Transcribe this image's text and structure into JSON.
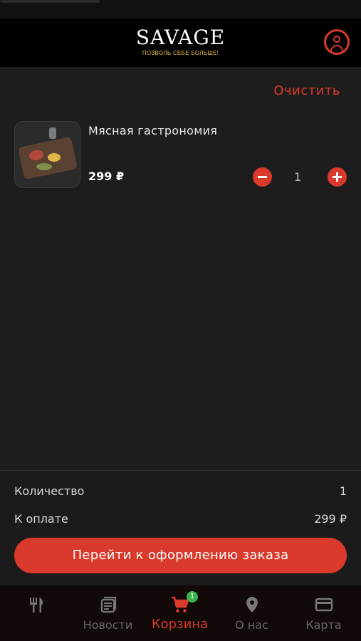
{
  "header": {
    "logo_title": "SAVAGE",
    "logo_tagline": "ПОЗВОЛЬ СЕБЕ БОЛЬШЕ!",
    "profile_icon": "account-circle-icon"
  },
  "cart": {
    "clear_label": "Очистить",
    "items": [
      {
        "name": "Мясная гастрономия",
        "price": "299 ₽",
        "quantity": "1",
        "image": "meat-platter-photo"
      }
    ]
  },
  "summary": {
    "quantity_label": "Количество",
    "quantity_value": "1",
    "total_label": "К оплате",
    "total_value": "299 ₽",
    "checkout_label": "Перейти к оформлению заказа"
  },
  "tabbar": {
    "tabs": [
      {
        "label": "",
        "icon": "fork-knife-icon"
      },
      {
        "label": "Новости",
        "icon": "news-icon"
      },
      {
        "label": "Корзина",
        "icon": "cart-icon",
        "active": true,
        "badge": "1"
      },
      {
        "label": "О нас",
        "icon": "location-pin-icon"
      },
      {
        "label": "Карта",
        "icon": "card-icon"
      }
    ]
  },
  "colors": {
    "accent": "#d93a2b",
    "background": "#1d1d1d",
    "badge": "#3bb24a",
    "tagline": "#e8c24a"
  }
}
